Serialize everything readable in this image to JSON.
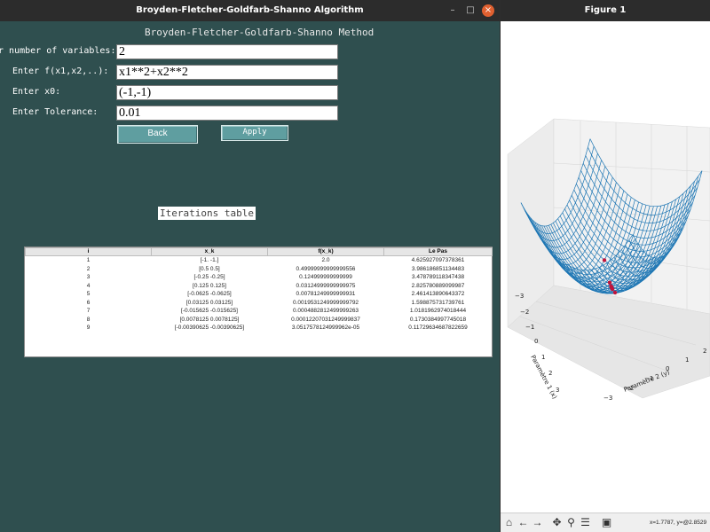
{
  "left_window": {
    "title": "Broyden-Fletcher-Goldfarb-Shanno Algorithm",
    "heading": "Broyden-Fletcher-Goldfarb-Shanno Method",
    "fields": [
      {
        "label": "er number of variables:",
        "value": "2"
      },
      {
        "label": "Enter f(x1,x2,..):",
        "value": "x1**2+x2**2"
      },
      {
        "label": "Enter x0:",
        "value": "(-1,-1)"
      },
      {
        "label": "Enter Tolerance:",
        "value": "0.01"
      }
    ],
    "back_label": "Back",
    "apply_label": "Apply",
    "table_title": "Iterations table",
    "table": {
      "headers": [
        "i",
        "x_k",
        "f(x_k)",
        "Le Pas"
      ],
      "rows": [
        [
          "1",
          "[-1. -1.]",
          "2.0",
          "4.625927097378361"
        ],
        [
          "2",
          "[0.5 0.5]",
          "0.49999999999999556",
          "3.986186851134483"
        ],
        [
          "3",
          "[-0.25 -0.25]",
          "0.124999999999999",
          "3.478789118347438"
        ],
        [
          "4",
          "[0.125 0.125]",
          "0.03124999999999975",
          "2.825780889099987"
        ],
        [
          "5",
          "[-0.0625 -0.0625]",
          "0.00781249999999931",
          "2.461413890643372"
        ],
        [
          "6",
          "[0.03125 0.03125]",
          "0.0019531249999999792",
          "1.598875731739761"
        ],
        [
          "7",
          "[-0.015625 -0.015625]",
          "0.0004882812499999263",
          "1.0181962974018444"
        ],
        [
          "8",
          "[0.0078125 0.0078125]",
          "0.00012207031249999837",
          "0.1730384997745018"
        ],
        [
          "9",
          "[-0.00390625 -0.00390625]",
          "3.0517578124999962e-05",
          "0.11729634687822659"
        ]
      ]
    }
  },
  "right_window": {
    "title": "Figure 1",
    "coords_text": "x=1.7787, y=@2.8529",
    "toolbar_icons": [
      "home-icon",
      "back-arrow-icon",
      "forward-arrow-icon",
      "pan-icon",
      "zoom-icon",
      "configure-icon",
      "save-icon"
    ],
    "plot": {
      "xlabel": "Paramètre 1 (x)",
      "ylabel": "Paramètre 2 (y)",
      "x_ticks": [
        "−3",
        "−2",
        "−1",
        "0",
        "1",
        "2",
        "3"
      ],
      "y_ticks": [
        "−3",
        "−2",
        "−1",
        "0",
        "1",
        "2"
      ],
      "surface_color": "#1f77b4",
      "points_color": "#c0143c"
    }
  },
  "colors": {
    "app_background": "#2f4f4f",
    "button": "#5f9ea0",
    "titlebar": "#2c2c2c",
    "close_button": "#e06030"
  }
}
